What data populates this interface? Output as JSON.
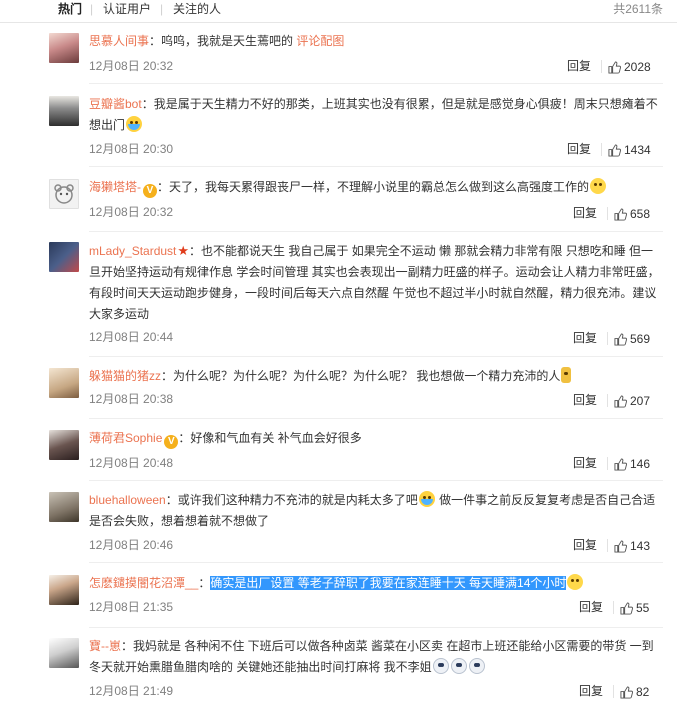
{
  "tabs": [
    {
      "label": "热门",
      "active": true
    },
    {
      "label": "认证用户",
      "active": false
    },
    {
      "label": "关注的人",
      "active": false
    }
  ],
  "total_label": "共2611条",
  "reply_label": "回复",
  "comments": [
    {
      "user": "思慕人间事",
      "text": "：呜呜，我就是天生蔫吧的 ",
      "link": "评论配图",
      "time": "12月08日 20:32",
      "likes": "2028"
    },
    {
      "user": "豆瓣酱bot",
      "text": "：我是属于天生精力不好的那类，上班其实也没有很累，但是就是感觉身心俱疲！周末只想瘫着不想出门",
      "time": "12月08日 20:30",
      "likes": "1434"
    },
    {
      "user": "海獭塔塔-",
      "text": "：天了，我每天累得跟丧尸一样，不理解小说里的霸总怎么做到这么高强度工作的",
      "time": "12月08日 20:32",
      "likes": "658"
    },
    {
      "user": "mLady_Stardust",
      "text": "：也不能都说天生 我自己属于 如果完全不运动 懒 那就会精力非常有限 只想吃和睡 但一旦开始坚持运动有规律作息 学会时间管理 其实也会表现出一副精力旺盛的样子。运动会让人精力非常旺盛，有段时间天天运动跑步健身，一段时间后每天六点自然醒 午觉也不超过半小时就自然醒，精力很充沛。建议大家多运动",
      "time": "12月08日 20:44",
      "likes": "569"
    },
    {
      "user": "躲猫猫的猪zz",
      "text": "：为什么呢？为什么呢？为什么呢？为什么呢？ 我也想做一个精力充沛的人",
      "time": "12月08日 20:38",
      "likes": "207"
    },
    {
      "user": "薄荷君Sophie",
      "text": "：好像和气血有关 补气血会好很多",
      "time": "12月08日 20:48",
      "likes": "146"
    },
    {
      "user": "bluehalloween",
      "text": "：或许我们这种精力不充沛的就是内耗太多了吧",
      "text2": " 做一件事之前反反复复考虑是否自己合适是否会失败，想着想着就不想做了",
      "time": "12月08日 20:46",
      "likes": "143"
    },
    {
      "user": "怎麽鑓摸闇花沼潭__",
      "text": "：",
      "highlight": "确实是出厂设置 等老子辞职了我要在家连睡十天 每天睡满14个小时",
      "time": "12月08日 21:35",
      "likes": "55"
    },
    {
      "user": "寶--崽",
      "text": "：我妈就是 各种闲不住 下班后可以做各种卤菜 酱菜在小区卖 在超市上班还能给小区需要的带货 一到冬天就开始熏腊鱼腊肉啥的 关键她还能抽出时间打麻将 我不李姐",
      "time": "12月08日 21:49",
      "likes": "82"
    }
  ]
}
